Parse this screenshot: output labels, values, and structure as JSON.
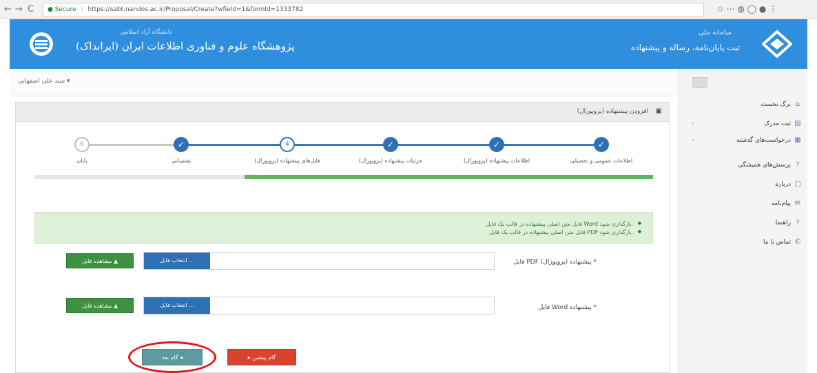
{
  "browser": {
    "back": "←",
    "forward": "→",
    "reload": "C",
    "secure": "● Secure",
    "url": "https://sabt.nandos.ac.ir/Proposal/Create?wfield=1&formId=1333782",
    "tools": "☆  ⋯  ◍  ◯  ●  ⋮"
  },
  "header": {
    "uni_subtitle": "دانشگاه آزاد اسلامی",
    "uni_title": "پژوهشگاه علوم و فناوری اطلاعات ایران (ایرانداک)",
    "sys_subtitle": "سامانه ملی",
    "sys_title": "ثبت پایان‌نامه، رساله و پیشنهاده"
  },
  "user": {
    "name": "سید علی اصفهانی ▾"
  },
  "sidebar": {
    "items": [
      {
        "label": "برگ نخست",
        "icon": "home-icon",
        "glyph": "⌂"
      },
      {
        "label": "ثبت مدرک",
        "icon": "document-icon",
        "glyph": "▤",
        "chevron": "‹"
      },
      {
        "label": "درخواست‌های گذشته",
        "icon": "list-icon",
        "glyph": "▦",
        "chevron": "‹"
      },
      {
        "label": "پرسش‌های همیشگی",
        "icon": "question-icon",
        "glyph": "?"
      },
      {
        "label": "درباره",
        "icon": "info-icon",
        "glyph": "▢"
      },
      {
        "label": "پیام‌نامه",
        "icon": "mail-icon",
        "glyph": "✉"
      },
      {
        "label": "راهنما",
        "icon": "help-icon",
        "glyph": "?"
      },
      {
        "label": "تماس با ما",
        "icon": "phone-icon",
        "glyph": "✆"
      }
    ]
  },
  "panel": {
    "title": "افزودن پیشنهاده (پروپوزال)",
    "icon_glyph": "▣"
  },
  "wizard": {
    "steps": [
      {
        "label": "اطلاعات عمومی و تحصیلی",
        "state": "done",
        "glyph": "✓"
      },
      {
        "label": "اطلاعات پیشنهاده (پروپوزال)",
        "state": "done",
        "glyph": "✓"
      },
      {
        "label": "جزئیات پیشنهاده (پروپوزال)",
        "state": "done",
        "glyph": "✓"
      },
      {
        "label": "فایل‌های پیشنهاده (پروپوزال)",
        "state": "current",
        "glyph": "4"
      },
      {
        "label": "پشتیبانی",
        "state": "done",
        "glyph": "✓"
      },
      {
        "label": "پایان",
        "state": "todo",
        "glyph": "6"
      }
    ],
    "progress": 0.66
  },
  "alert": {
    "line1": "فایل متن اصلی پیشنهاده در قالب یک فایل Word بارگذاری شود.",
    "line2": "فایل متن اصلی پیشنهاده در قالب یک فایل PDF بارگذاری شود."
  },
  "uploads": [
    {
      "label": "فایل PDF (پروپوزال) پیشنهاده *",
      "pick": "انتخاب فایل ...",
      "view": "مشاهده فایل ▲"
    },
    {
      "label": "فایل Word پیشنهاده *",
      "pick": "انتخاب فایل ...",
      "view": "مشاهده فایل ▲"
    }
  ],
  "buttons": {
    "next": "گام بعد ◂",
    "prev": "▸ گام پیشین"
  },
  "colors": {
    "header": "#2f8ede",
    "primary": "#2f6fb4",
    "success": "#5cb85c",
    "danger": "#d9432e",
    "highlight": "#e0161a"
  }
}
